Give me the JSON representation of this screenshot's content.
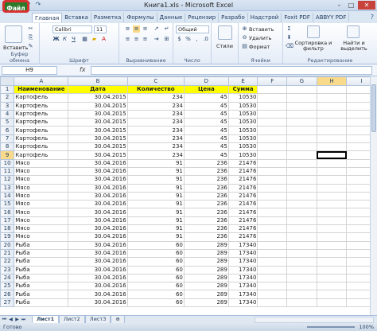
{
  "window": {
    "title": "Книга1.xls - Microsoft Excel",
    "controls": [
      "minimize-icon",
      "maximize-icon",
      "close-icon"
    ]
  },
  "ribbon_tabs": {
    "file": "Файл",
    "items": [
      "Главная",
      "Вставка",
      "Разметка",
      "Формулы",
      "Данные",
      "Рецензир",
      "Разрабо",
      "Надстрой",
      "Foxit PDF",
      "ABBYY PDF"
    ],
    "active": "Главная"
  },
  "ribbon": {
    "clipboard": {
      "paste": "Вставить",
      "label": "Буфер обмена"
    },
    "font": {
      "name": "Calibri",
      "size": "11",
      "label": "Шрифт"
    },
    "alignment": {
      "label": "Выравнивание"
    },
    "number": {
      "format": "Общий",
      "label": "Число"
    },
    "styles": {
      "btn": "Стили"
    },
    "cells": {
      "insert": "Вставить",
      "delete": "Удалить",
      "format": "Формат",
      "label": "Ячейки"
    },
    "editing": {
      "sort": "Сортировка и фильтр",
      "find": "Найти и выделить",
      "label": "Редактирование"
    }
  },
  "formula_bar": {
    "name_box": "H9",
    "fx": "fx",
    "value": ""
  },
  "columns": [
    "A",
    "B",
    "C",
    "D",
    "E",
    "F",
    "G",
    "H",
    "I"
  ],
  "selected": {
    "column": "H",
    "row": 9
  },
  "table": {
    "headers": [
      "Наименование",
      "Дата",
      "Количество",
      "Цена",
      "Сумма"
    ],
    "rows": [
      [
        "Картофель",
        "30.04.2015",
        "234",
        "45",
        "10530"
      ],
      [
        "Картофель",
        "30.04.2015",
        "234",
        "45",
        "10530"
      ],
      [
        "Картофель",
        "30.04.2015",
        "234",
        "45",
        "10530"
      ],
      [
        "Картофель",
        "30.04.2015",
        "234",
        "45",
        "10530"
      ],
      [
        "Картофель",
        "30.04.2015",
        "234",
        "45",
        "10530"
      ],
      [
        "Картофель",
        "30.04.2015",
        "234",
        "45",
        "10530"
      ],
      [
        "Картофель",
        "30.04.2015",
        "234",
        "45",
        "10530"
      ],
      [
        "Картофель",
        "30.04.2015",
        "234",
        "45",
        "10530"
      ],
      [
        "Мясо",
        "30.04.2016",
        "91",
        "236",
        "21476"
      ],
      [
        "Мясо",
        "30.04.2016",
        "91",
        "236",
        "21476"
      ],
      [
        "Мясо",
        "30.04.2016",
        "91",
        "236",
        "21476"
      ],
      [
        "Мясо",
        "30.04.2016",
        "91",
        "236",
        "21476"
      ],
      [
        "Мясо",
        "30.04.2016",
        "91",
        "236",
        "21476"
      ],
      [
        "Мясо",
        "30.04.2016",
        "91",
        "236",
        "21476"
      ],
      [
        "Мясо",
        "30.04.2016",
        "91",
        "236",
        "21476"
      ],
      [
        "Мясо",
        "30.04.2016",
        "91",
        "236",
        "21476"
      ],
      [
        "Мясо",
        "30.04.2016",
        "91",
        "236",
        "21476"
      ],
      [
        "Мясо",
        "30.04.2016",
        "91",
        "236",
        "21476"
      ],
      [
        "Рыба",
        "30.04.2016",
        "60",
        "289",
        "17340"
      ],
      [
        "Рыба",
        "30.04.2016",
        "60",
        "289",
        "17340"
      ],
      [
        "Рыба",
        "30.04.2016",
        "60",
        "289",
        "17340"
      ],
      [
        "Рыба",
        "30.04.2016",
        "60",
        "289",
        "17340"
      ],
      [
        "Рыба",
        "30.04.2016",
        "60",
        "289",
        "17340"
      ],
      [
        "Рыба",
        "30.04.2016",
        "60",
        "289",
        "17340"
      ],
      [
        "Рыба",
        "30.04.2016",
        "60",
        "289",
        "17340"
      ],
      [
        "Рыба",
        "30.04.2016",
        "60",
        "289",
        "17340"
      ]
    ],
    "highlight_color": "#ffff00"
  },
  "sheets": [
    "Лист1",
    "Лист2",
    "Лист3"
  ],
  "active_sheet": "Лист1",
  "status": {
    "text": "Готово",
    "zoom": "100%"
  },
  "colors": {
    "file_tab": "#2a7a2a",
    "file_tab_outline": "#d93030",
    "selection_header": "#f9d98a"
  }
}
